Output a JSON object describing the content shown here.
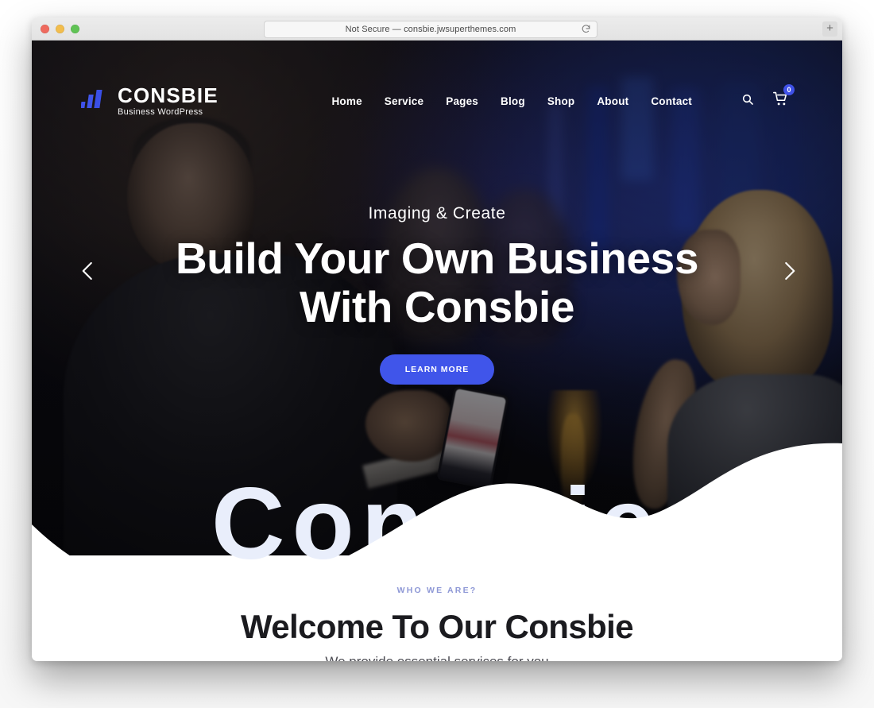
{
  "browser": {
    "url_text": "Not Secure — consbie.jwsuperthemes.com",
    "reload_icon": "reload-icon",
    "new_tab_label": "+",
    "traffic_lights": [
      "close",
      "minimize",
      "maximize"
    ]
  },
  "site": {
    "logo": {
      "title": "CONSBIE",
      "subtitle": "Business WordPress",
      "mark_icon": "bar-chart-logo-icon",
      "accent_color": "#3f51e8"
    },
    "nav": {
      "items": [
        {
          "label": "Home"
        },
        {
          "label": "Service"
        },
        {
          "label": "Pages"
        },
        {
          "label": "Blog"
        },
        {
          "label": "Shop"
        },
        {
          "label": "About"
        },
        {
          "label": "Contact"
        }
      ],
      "search_icon": "search-icon",
      "cart_icon": "shopping-cart-icon",
      "cart_count": "0"
    },
    "hero": {
      "subtitle": "Imaging & Create",
      "title_line1": "Build Your Own Business",
      "title_line2": "With Consbie",
      "cta_label": "LEARN MORE",
      "cta_color": "#4055ea",
      "prev_icon": "chevron-left-icon",
      "next_icon": "chevron-right-icon",
      "watermark": "Consbie",
      "watermark_color": "#e9eefb"
    },
    "welcome": {
      "eyebrow": "WHO WE ARE?",
      "eyebrow_color": "#8e98d6",
      "title": "Welcome To Our Consbie",
      "subtitle": "We provide essential services for you",
      "divider_color": "#8890b5"
    }
  }
}
